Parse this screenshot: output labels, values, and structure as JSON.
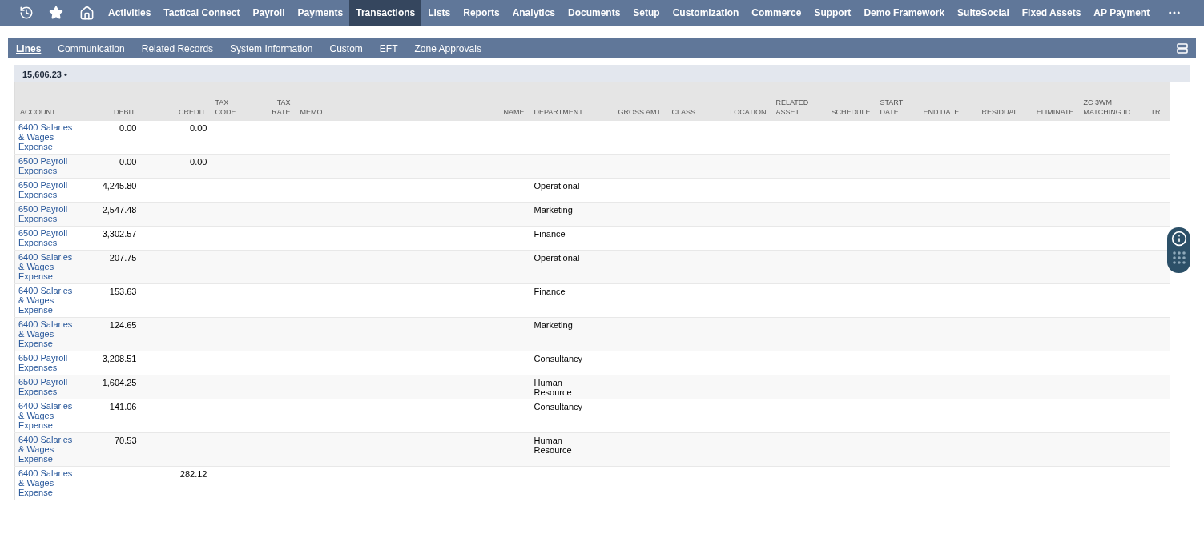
{
  "nav": {
    "items": [
      {
        "label": "Activities",
        "selected": false
      },
      {
        "label": "Tactical Connect",
        "selected": false
      },
      {
        "label": "Payroll",
        "selected": false
      },
      {
        "label": "Payments",
        "selected": false
      },
      {
        "label": "Transactions",
        "selected": true
      },
      {
        "label": "Lists",
        "selected": false
      },
      {
        "label": "Reports",
        "selected": false
      },
      {
        "label": "Analytics",
        "selected": false
      },
      {
        "label": "Documents",
        "selected": false
      },
      {
        "label": "Setup",
        "selected": false
      },
      {
        "label": "Customization",
        "selected": false
      },
      {
        "label": "Commerce",
        "selected": false
      },
      {
        "label": "Support",
        "selected": false
      },
      {
        "label": "Demo Framework",
        "selected": false
      },
      {
        "label": "SuiteSocial",
        "selected": false
      },
      {
        "label": "Fixed Assets",
        "selected": false
      },
      {
        "label": "AP Payment",
        "selected": false
      }
    ]
  },
  "subtabs": [
    {
      "label": "Lines",
      "selected": true
    },
    {
      "label": "Communication",
      "selected": false
    },
    {
      "label": "Related Records",
      "selected": false
    },
    {
      "label": "System Information",
      "selected": false
    },
    {
      "label": "Custom",
      "selected": false
    },
    {
      "label": "EFT",
      "selected": false
    },
    {
      "label": "Zone Approvals",
      "selected": false
    }
  ],
  "total_tab": {
    "label": "15,606.23 •"
  },
  "table": {
    "columns": [
      "ACCOUNT",
      "DEBIT",
      "CREDIT",
      "TAX CODE",
      "TAX RATE",
      "MEMO",
      "NAME",
      "DEPARTMENT",
      "GROSS AMT.",
      "CLASS",
      "LOCATION",
      "RELATED ASSET",
      "SCHEDULE",
      "START DATE",
      "END DATE",
      "RESIDUAL",
      "ELIMINATE",
      "ZC 3WM MATCHING ID",
      "TR"
    ],
    "rows": [
      {
        "account": "6400 Salaries & Wages Expense",
        "debit": "0.00",
        "credit": "0.00"
      },
      {
        "account": "6500 Payroll Expenses",
        "debit": "0.00",
        "credit": "0.00"
      },
      {
        "account": "6500 Payroll Expenses",
        "debit": "4,245.80",
        "department": "Operational"
      },
      {
        "account": "6500 Payroll Expenses",
        "debit": "2,547.48",
        "department": "Marketing"
      },
      {
        "account": "6500 Payroll Expenses",
        "debit": "3,302.57",
        "department": "Finance"
      },
      {
        "account": "6400 Salaries & Wages Expense",
        "debit": "207.75",
        "department": "Operational"
      },
      {
        "account": "6400 Salaries & Wages Expense",
        "debit": "153.63",
        "department": "Finance"
      },
      {
        "account": "6400 Salaries & Wages Expense",
        "debit": "124.65",
        "department": "Marketing"
      },
      {
        "account": "6500 Payroll Expenses",
        "debit": "3,208.51",
        "department": "Consultancy"
      },
      {
        "account": "6500 Payroll Expenses",
        "debit": "1,604.25",
        "department": "Human Resource"
      },
      {
        "account": "6400 Salaries & Wages Expense",
        "debit": "141.06",
        "department": "Consultancy"
      },
      {
        "account": "6400 Salaries & Wages Expense",
        "debit": "70.53",
        "department": "Human Resource"
      },
      {
        "account": "6400 Salaries & Wages Expense",
        "credit": "282.12"
      }
    ]
  }
}
